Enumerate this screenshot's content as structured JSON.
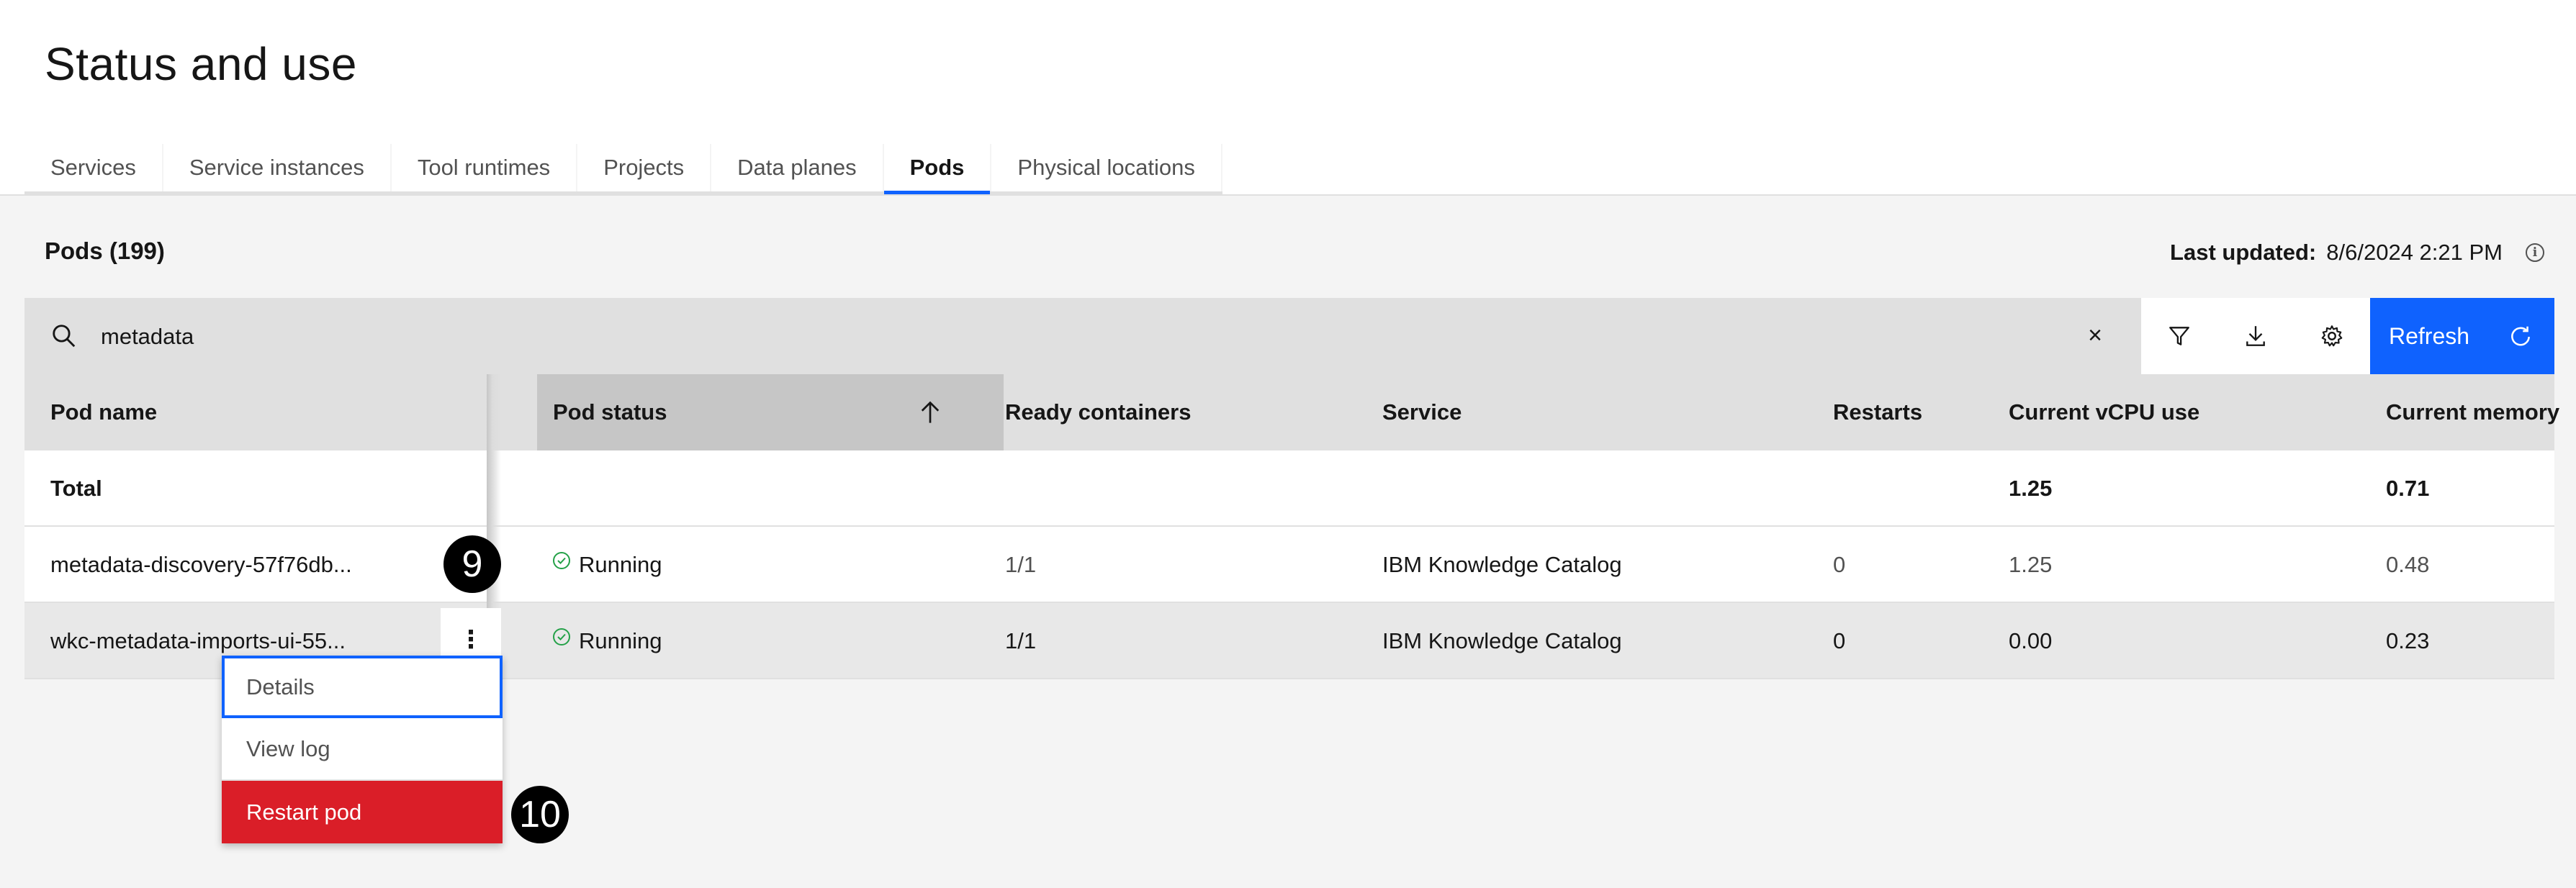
{
  "page": {
    "title": "Status and use"
  },
  "tabs": [
    {
      "label": "Services"
    },
    {
      "label": "Service instances"
    },
    {
      "label": "Tool runtimes"
    },
    {
      "label": "Projects"
    },
    {
      "label": "Data planes"
    },
    {
      "label": "Pods",
      "active": true
    },
    {
      "label": "Physical locations"
    }
  ],
  "section": {
    "title": "Pods (199)",
    "last_updated_label": "Last updated:",
    "last_updated_value": "8/6/2024 2:21 PM"
  },
  "toolbar": {
    "search_value": "metadata",
    "clear_icon": "close-icon",
    "filter_icon": "filter-icon",
    "download_icon": "download-icon",
    "settings_icon": "gear-icon",
    "refresh_label": "Refresh",
    "refresh_icon": "refresh-icon"
  },
  "table": {
    "columns": [
      "Pod name",
      "Pod status",
      "Ready containers",
      "Service",
      "Restarts",
      "Current vCPU use",
      "Current memory"
    ],
    "sorted_column": "Pod status",
    "sort_direction": "ascending",
    "total": {
      "label": "Total",
      "cpu": "1.25",
      "memory": "0.71"
    },
    "rows": [
      {
        "name": "metadata-discovery-57f76db...",
        "status": "Running",
        "ready": "1/1",
        "service": "IBM Knowledge Catalog",
        "restarts": "0",
        "cpu": "1.25",
        "memory": "0.48"
      },
      {
        "name": "wkc-metadata-imports-ui-55...",
        "status": "Running",
        "ready": "1/1",
        "service": "IBM Knowledge Catalog",
        "restarts": "0",
        "cpu": "0.00",
        "memory": "0.23"
      }
    ]
  },
  "overflow_menu": {
    "items": [
      {
        "label": "Details"
      },
      {
        "label": "View log"
      },
      {
        "label": "Restart pod"
      }
    ]
  },
  "callouts": {
    "first": "9",
    "second": "10"
  },
  "colors": {
    "accent": "#0f62fe",
    "danger": "#da1e28",
    "success": "#24a148"
  }
}
